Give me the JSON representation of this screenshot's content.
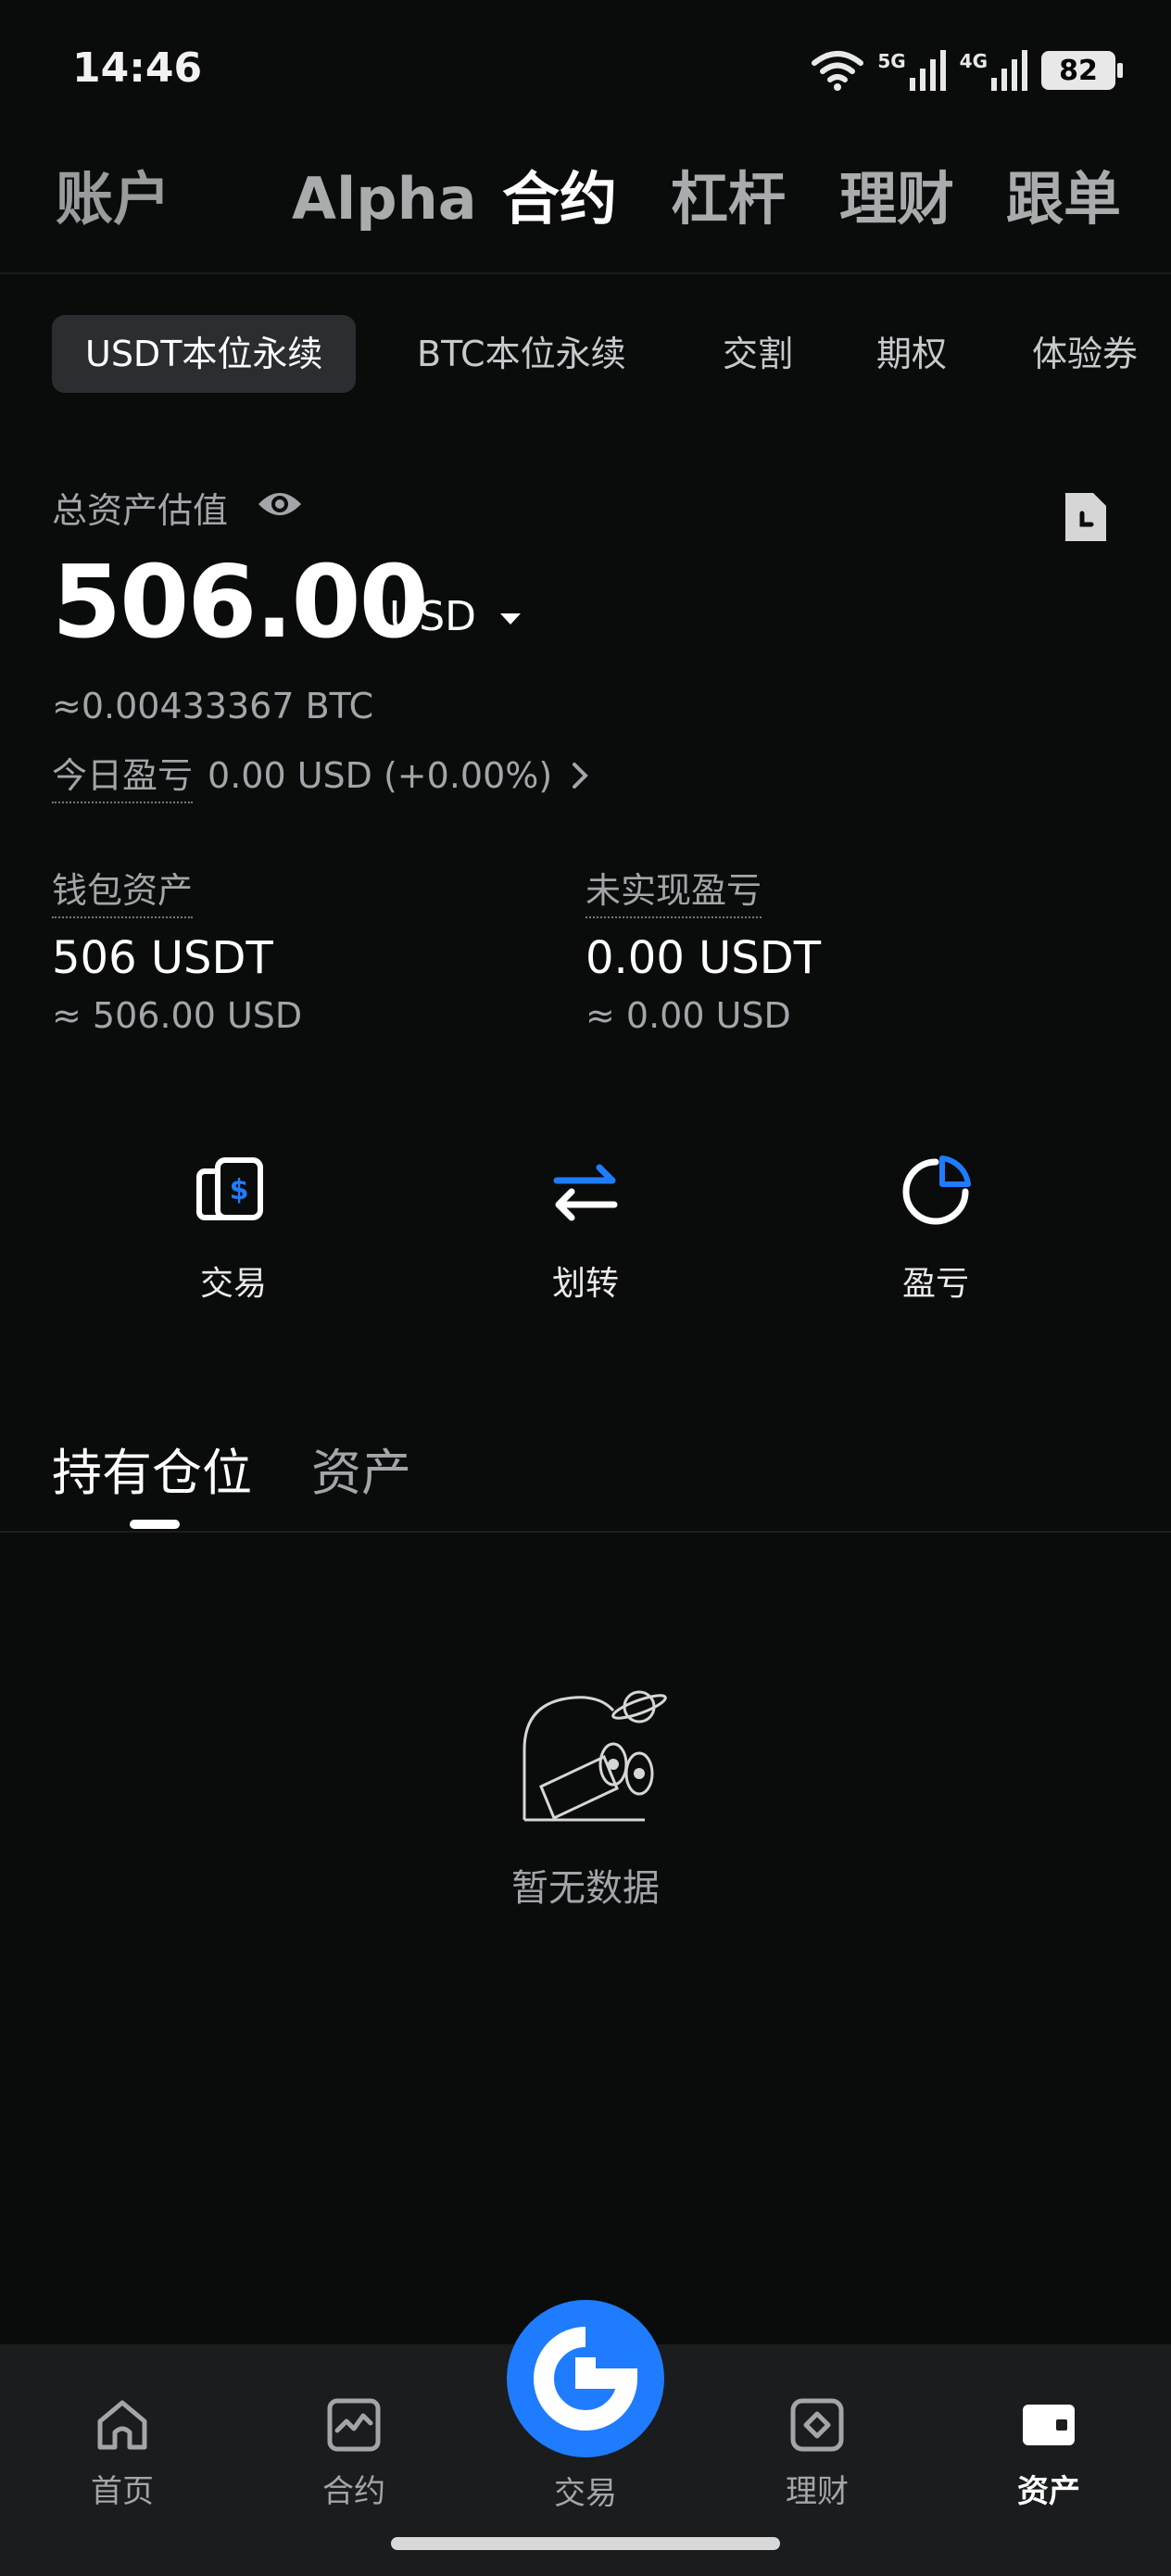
{
  "status_bar": {
    "time": "14:46",
    "battery": "82",
    "net1": "5G",
    "net2": "4G"
  },
  "top_tabs": [
    "账户",
    "Alpha",
    "合约",
    "杠杆",
    "理财",
    "跟单"
  ],
  "top_tab_active": "合约",
  "sub_tabs": [
    "USDT本位永续",
    "BTC本位永续",
    "交割",
    "期权",
    "体验券"
  ],
  "summary": {
    "label": "总资产估值",
    "value": "506.00",
    "unit": "USD",
    "btc_equiv": "≈0.00433367 BTC",
    "today_pnl_label": "今日盈亏",
    "today_pnl_value": "0.00 USD (+0.00%)"
  },
  "wallet": {
    "label": "钱包资产",
    "value": "506 USDT",
    "approx": "≈ 506.00 USD"
  },
  "unrealized": {
    "label": "未实现盈亏",
    "value": "0.00 USDT",
    "approx": "≈ 0.00 USD"
  },
  "actions": [
    "交易",
    "划转",
    "盈亏"
  ],
  "position_tabs": [
    "持有仓位",
    "资产"
  ],
  "empty_text": "暂无数据",
  "bottom_nav": [
    "首页",
    "合约",
    "交易",
    "理财",
    "资产"
  ],
  "colors": {
    "accent": "#1f7cff",
    "background": "#0a0b0b",
    "nav_bg": "#1a1c1e"
  }
}
